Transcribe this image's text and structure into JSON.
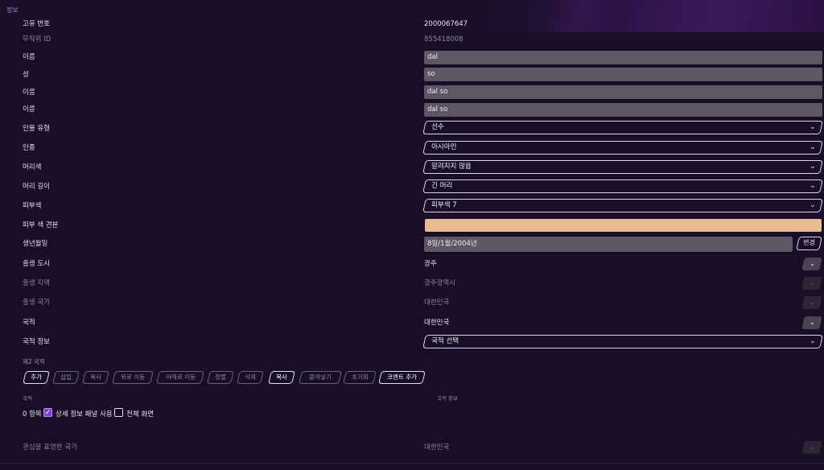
{
  "section_title": "정보",
  "fields": {
    "unique_id": {
      "label": "고유 번호",
      "value": "2000067647"
    },
    "random_id": {
      "label": "무작위 ID",
      "value": "855418008"
    },
    "first_name": {
      "label": "이름",
      "value": "dal"
    },
    "last_name": {
      "label": "성",
      "value": "so"
    },
    "full_name": {
      "label": "이름",
      "value": "dal so"
    },
    "common_name": {
      "label": "이름",
      "value": "dal so"
    },
    "person_type": {
      "label": "인물 유형",
      "value": "선수"
    },
    "ethnicity": {
      "label": "인종",
      "value": "아시아인"
    },
    "hair_color": {
      "label": "머리색",
      "value": "알려지지 않음"
    },
    "hair_length": {
      "label": "머리 길이",
      "value": "긴 머리"
    },
    "skin_tone": {
      "label": "피부색",
      "value": "피부색 7"
    },
    "skin_sample": {
      "label": "피부 색 견본",
      "color": "#e8bb91"
    },
    "birth_date": {
      "label": "생년월일",
      "value": "8일/1월/2004년",
      "button": "변경"
    },
    "birth_city": {
      "label": "출생 도시",
      "value": "광주"
    },
    "birth_region": {
      "label": "출생 지역",
      "value": "광주광역시"
    },
    "birth_country": {
      "label": "출생 국가",
      "value": "대한민국"
    },
    "nationality": {
      "label": "국적",
      "value": "대한민국"
    },
    "nationality_info": {
      "label": "국적 정보",
      "value": "국적 선택"
    }
  },
  "second_nationality": {
    "title": "제2 국적",
    "toolbar": [
      "추가",
      "삽입",
      "복사",
      "위로 이동",
      "아래로 이동",
      "정렬",
      "삭제",
      "복사",
      "붙여넣기",
      "초기화",
      "코멘트 추가"
    ],
    "columns": [
      "국적",
      "국적 정보"
    ],
    "count_text": "0 항목",
    "detail_panel_label": "상세 정보 패널 사용",
    "fullscreen_label": "전체 화면"
  },
  "interest_country": {
    "label": "관심을 표명한 국가",
    "value": "대한민국"
  },
  "icons": {
    "chevron": "chevron-down-icon",
    "check": "check-icon"
  }
}
